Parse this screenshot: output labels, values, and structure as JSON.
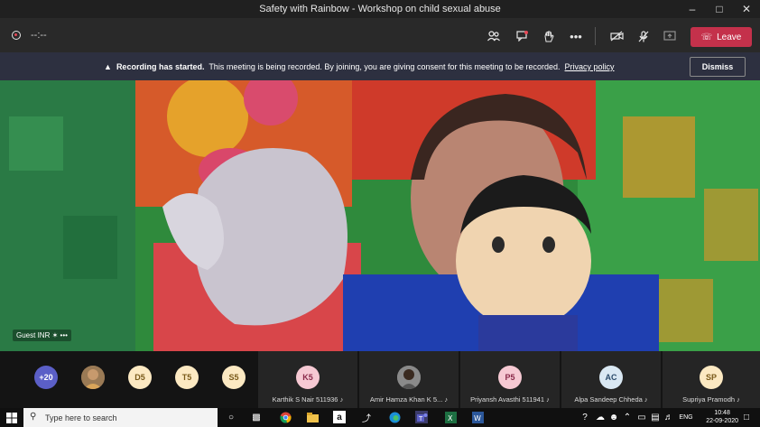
{
  "window": {
    "title": "Safety with Rainbow - Workshop on child sexual abuse"
  },
  "toolbar": {
    "timer": "--:--",
    "leave_label": "Leave"
  },
  "banner": {
    "bold": "Recording has started.",
    "text": "This meeting is being recorded. By joining, you are giving consent for this meeting to be recorded.",
    "link": "Privacy policy",
    "dismiss_label": "Dismiss"
  },
  "video": {
    "participant": "Guest INR"
  },
  "participants": {
    "overflow": "+20",
    "small": [
      {
        "initials": "D5",
        "color": "#fce9c2"
      },
      {
        "initials": "T5",
        "color": "#fce9c2"
      },
      {
        "initials": "S5",
        "color": "#fce9c2"
      }
    ],
    "tiles": [
      {
        "initials": "K5",
        "name": "Karthik S Nair 511936",
        "color": "#f6c9d3"
      },
      {
        "initials": "",
        "name": "Amir Hamza Khan K 5...",
        "color": "#777"
      },
      {
        "initials": "P5",
        "name": "Priyansh Avasthi 511941",
        "color": "#f6c9d3"
      },
      {
        "initials": "AC",
        "name": "Alpa Sandeep Chheda",
        "color": "#d9e8f3"
      },
      {
        "initials": "SP",
        "name": "Supriya Pramodh",
        "color": "#fce9c2"
      }
    ]
  },
  "taskbar": {
    "search_placeholder": "Type here to search",
    "language": "ENG",
    "time": "10:48",
    "date": "22-09-2020"
  }
}
